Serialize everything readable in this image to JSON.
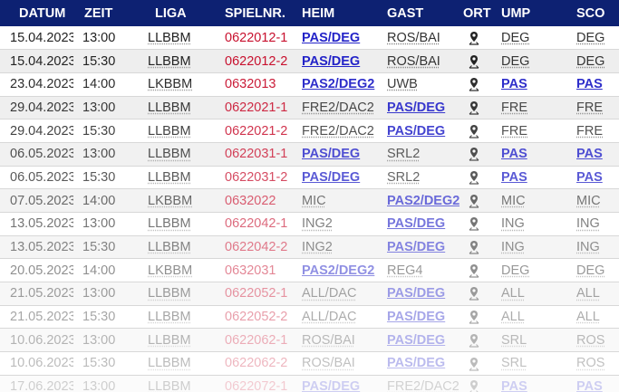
{
  "headers": [
    "DATUM",
    "ZEIT",
    "LIGA",
    "SPIELNR.",
    "HEIM",
    "GAST",
    "ORT",
    "UMP",
    "SCO"
  ],
  "rows": [
    {
      "datum": "15.04.2023",
      "zeit": "13:00",
      "liga": "LLBBM",
      "spielnr": "0622012-1",
      "heim": "PAS/DEG",
      "heim_team": true,
      "gast": "ROS/BAI",
      "gast_team": false,
      "ump": "DEG",
      "ump_team": false,
      "sco": "DEG",
      "sco_team": false,
      "opacity": 1.0
    },
    {
      "datum": "15.04.2023",
      "zeit": "15:30",
      "liga": "LLBBM",
      "spielnr": "0622012-2",
      "heim": "PAS/DEG",
      "heim_team": true,
      "gast": "ROS/BAI",
      "gast_team": false,
      "ump": "DEG",
      "ump_team": false,
      "sco": "DEG",
      "sco_team": false,
      "opacity": 1.0
    },
    {
      "datum": "23.04.2023",
      "zeit": "14:00",
      "liga": "LKBBM",
      "spielnr": "0632013",
      "heim": "PAS2/DEG2",
      "heim_team": true,
      "gast": "UWB",
      "gast_team": false,
      "ump": "PAS",
      "ump_team": true,
      "sco": "PAS",
      "sco_team": true,
      "opacity": 0.95
    },
    {
      "datum": "29.04.2023",
      "zeit": "13:00",
      "liga": "LLBBM",
      "spielnr": "0622021-1",
      "heim": "FRE2/DAC2",
      "heim_team": false,
      "gast": "PAS/DEG",
      "gast_team": true,
      "ump": "FRE",
      "ump_team": false,
      "sco": "FRE",
      "sco_team": false,
      "opacity": 0.9
    },
    {
      "datum": "29.04.2023",
      "zeit": "15:30",
      "liga": "LLBBM",
      "spielnr": "0622021-2",
      "heim": "FRE2/DAC2",
      "heim_team": false,
      "gast": "PAS/DEG",
      "gast_team": true,
      "ump": "FRE",
      "ump_team": false,
      "sco": "FRE",
      "sco_team": false,
      "opacity": 0.85
    },
    {
      "datum": "06.05.2023",
      "zeit": "13:00",
      "liga": "LLBBM",
      "spielnr": "0622031-1",
      "heim": "PAS/DEG",
      "heim_team": true,
      "gast": "SRL2",
      "gast_team": false,
      "ump": "PAS",
      "ump_team": true,
      "sco": "PAS",
      "sco_team": true,
      "opacity": 0.8
    },
    {
      "datum": "06.05.2023",
      "zeit": "15:30",
      "liga": "LLBBM",
      "spielnr": "0622031-2",
      "heim": "PAS/DEG",
      "heim_team": true,
      "gast": "SRL2",
      "gast_team": false,
      "ump": "PAS",
      "ump_team": true,
      "sco": "PAS",
      "sco_team": true,
      "opacity": 0.75
    },
    {
      "datum": "07.05.2023",
      "zeit": "14:00",
      "liga": "LKBBM",
      "spielnr": "0632022",
      "heim": "MIC",
      "heim_team": false,
      "gast": "PAS2/DEG2",
      "gast_team": true,
      "ump": "MIC",
      "ump_team": false,
      "sco": "MIC",
      "sco_team": false,
      "opacity": 0.68
    },
    {
      "datum": "13.05.2023",
      "zeit": "13:00",
      "liga": "LLBBM",
      "spielnr": "0622042-1",
      "heim": "ING2",
      "heim_team": false,
      "gast": "PAS/DEG",
      "gast_team": true,
      "ump": "ING",
      "ump_team": false,
      "sco": "ING",
      "sco_team": false,
      "opacity": 0.62
    },
    {
      "datum": "13.05.2023",
      "zeit": "15:30",
      "liga": "LLBBM",
      "spielnr": "0622042-2",
      "heim": "ING2",
      "heim_team": false,
      "gast": "PAS/DEG",
      "gast_team": true,
      "ump": "ING",
      "ump_team": false,
      "sco": "ING",
      "sco_team": false,
      "opacity": 0.56
    },
    {
      "datum": "20.05.2023",
      "zeit": "14:00",
      "liga": "LKBBM",
      "spielnr": "0632031",
      "heim": "PAS2/DEG2",
      "heim_team": true,
      "gast": "REG4",
      "gast_team": false,
      "ump": "DEG",
      "ump_team": false,
      "sco": "DEG",
      "sco_team": false,
      "opacity": 0.5
    },
    {
      "datum": "21.05.2023",
      "zeit": "13:00",
      "liga": "LLBBM",
      "spielnr": "0622052-1",
      "heim": "ALL/DAC",
      "heim_team": false,
      "gast": "PAS/DEG",
      "gast_team": true,
      "ump": "ALL",
      "ump_team": false,
      "sco": "ALL",
      "sco_team": false,
      "opacity": 0.45
    },
    {
      "datum": "21.05.2023",
      "zeit": "15:30",
      "liga": "LLBBM",
      "spielnr": "0622052-2",
      "heim": "ALL/DAC",
      "heim_team": false,
      "gast": "PAS/DEG",
      "gast_team": true,
      "ump": "ALL",
      "ump_team": false,
      "sco": "ALL",
      "sco_team": false,
      "opacity": 0.4
    },
    {
      "datum": "10.06.2023",
      "zeit": "13:00",
      "liga": "LLBBM",
      "spielnr": "0622062-1",
      "heim": "ROS/BAI",
      "heim_team": false,
      "gast": "PAS/DEG",
      "gast_team": true,
      "ump": "SRL",
      "ump_team": false,
      "sco": "ROS",
      "sco_team": false,
      "opacity": 0.34
    },
    {
      "datum": "10.06.2023",
      "zeit": "15:30",
      "liga": "LLBBM",
      "spielnr": "0622062-2",
      "heim": "ROS/BAI",
      "heim_team": false,
      "gast": "PAS/DEG",
      "gast_team": true,
      "ump": "SRL",
      "ump_team": false,
      "sco": "ROS",
      "sco_team": false,
      "opacity": 0.3
    },
    {
      "datum": "17.06.2023",
      "zeit": "13:00",
      "liga": "LLBBM",
      "spielnr": "0622072-1",
      "heim": "PAS/DEG",
      "heim_team": true,
      "gast": "FRE2/DAC2",
      "gast_team": false,
      "ump": "PAS",
      "ump_team": true,
      "sco": "PAS",
      "sco_team": true,
      "opacity": 0.22
    }
  ],
  "colors": {
    "header_bg": "#0d2172",
    "header_text": "#ffffff",
    "spielnr": "#c8102e",
    "team_link": "#2323c8",
    "stripe": "#eeeeee"
  },
  "ort_icon": "map-pin-icon"
}
